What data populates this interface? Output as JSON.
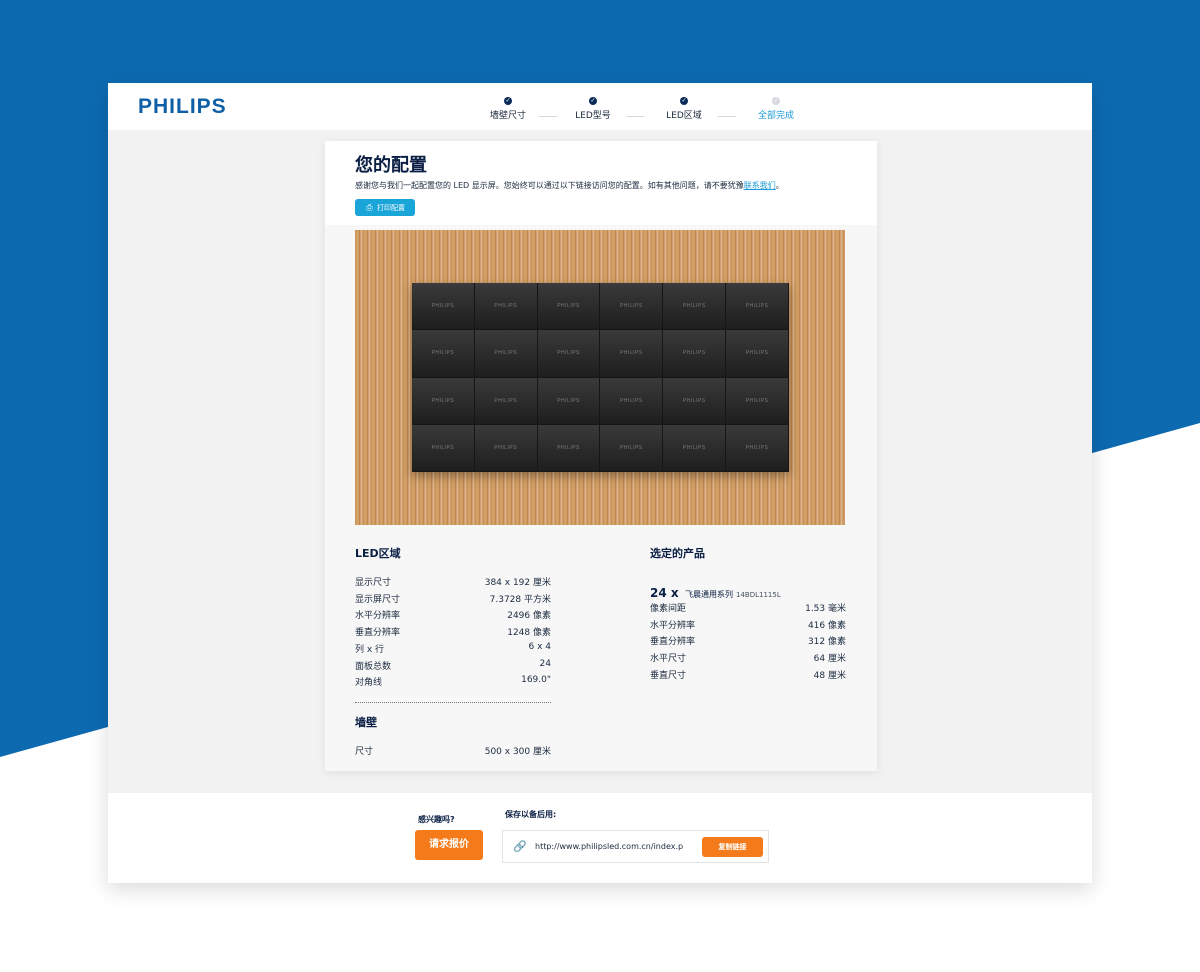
{
  "colors": {
    "brand_blue": "#0e5fa6",
    "navy": "#0b1f44",
    "accent_cyan": "#1aa5d8",
    "orange": "#f57b1a",
    "background_blue": "#0d6ab0"
  },
  "header": {
    "logo": "PHILIPS",
    "steps": [
      {
        "label": "墙壁尺寸",
        "done": true,
        "icon": "check-icon"
      },
      {
        "label": "LED型号",
        "done": true,
        "icon": "check-icon"
      },
      {
        "label": "LED区域",
        "done": true,
        "icon": "check-icon"
      },
      {
        "label": "全部完成",
        "done": false,
        "icon": "check-icon"
      }
    ]
  },
  "config": {
    "title": "您的配置",
    "description": "感谢您与我们一起配置您的 LED 显示屏。您始终可以通过以下链接访问您的配置。如有其他问题，请不要犹豫",
    "contact_link": "联系我们",
    "description_end": "。",
    "print_button": "打印配置",
    "print_icon": "printer-icon"
  },
  "wall_preview": {
    "columns": 6,
    "rows": 4,
    "tile_brand": "PHILIPS"
  },
  "led_area": {
    "title": "LED区域",
    "items": [
      {
        "label": "显示尺寸",
        "value": "384 x 192 厘米"
      },
      {
        "label": "显示屏尺寸",
        "value": "7.3728 平方米"
      },
      {
        "label": "水平分辨率",
        "value": "2496 像素"
      },
      {
        "label": "垂直分辨率",
        "value": "1248 像素"
      },
      {
        "label": "列 x 行",
        "value": "6 x 4"
      },
      {
        "label": "面板总数",
        "value": "24"
      },
      {
        "label": "对角线",
        "value": "169.0\""
      }
    ]
  },
  "wall": {
    "title": "墙壁",
    "items": [
      {
        "label": "尺寸",
        "value": "500 x 300 厘米"
      }
    ]
  },
  "selected_product": {
    "title": "选定的产品",
    "quantity": "24 x",
    "name": "飞晨通用系列",
    "model": "14BDL1115L",
    "items": [
      {
        "label": "像素间距",
        "value": "1.53 毫米"
      },
      {
        "label": "水平分辨率",
        "value": "416 像素"
      },
      {
        "label": "垂直分辨率",
        "value": "312 像素"
      },
      {
        "label": "水平尺寸",
        "value": "64 厘米"
      },
      {
        "label": "垂直尺寸",
        "value": "48 厘米"
      }
    ]
  },
  "footer": {
    "interest_label": "感兴趣吗?",
    "quote_button": "请求报价",
    "save_label": "保存以备后用:",
    "url": "http://www.philipsled.com.cn/index.p",
    "copy_button": "复制链接",
    "link_icon": "link-icon"
  }
}
